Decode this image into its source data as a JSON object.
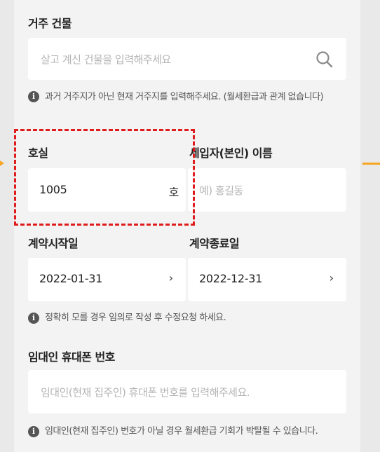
{
  "building": {
    "label": "거주 건물",
    "placeholder": "살고 계신 건물을 입력해주세요",
    "note": "과거 거주지가 아닌 현재 거주지를 입력해주세요. (월세환급과 관계 없습니다)",
    "search_icon": "search-icon"
  },
  "room": {
    "label": "호실",
    "value": "1005",
    "suffix": "호"
  },
  "tenant": {
    "label": "세입자(본인) 이름",
    "placeholder": "예) 홍길동"
  },
  "contract": {
    "start_label": "계약시작일",
    "start_value": "2022-01-31",
    "end_label": "계약종료일",
    "end_value": "2022-12-31",
    "chevron": "›",
    "note": "정확히 모를 경우 임의로 작성 후 수정요청 하세요."
  },
  "landlord": {
    "label": "임대인 휴대폰 번호",
    "placeholder": "임대인(현재 집주인) 휴대폰 번호를 입력해주세요.",
    "note": "임대인(현재 집주인) 번호가 아닐 경우 월세환급 기회가 박탈될 수 있습니다."
  },
  "info_glyph": "i",
  "colors": {
    "highlight": "#e01b1b",
    "arrow": "#f6a623"
  }
}
